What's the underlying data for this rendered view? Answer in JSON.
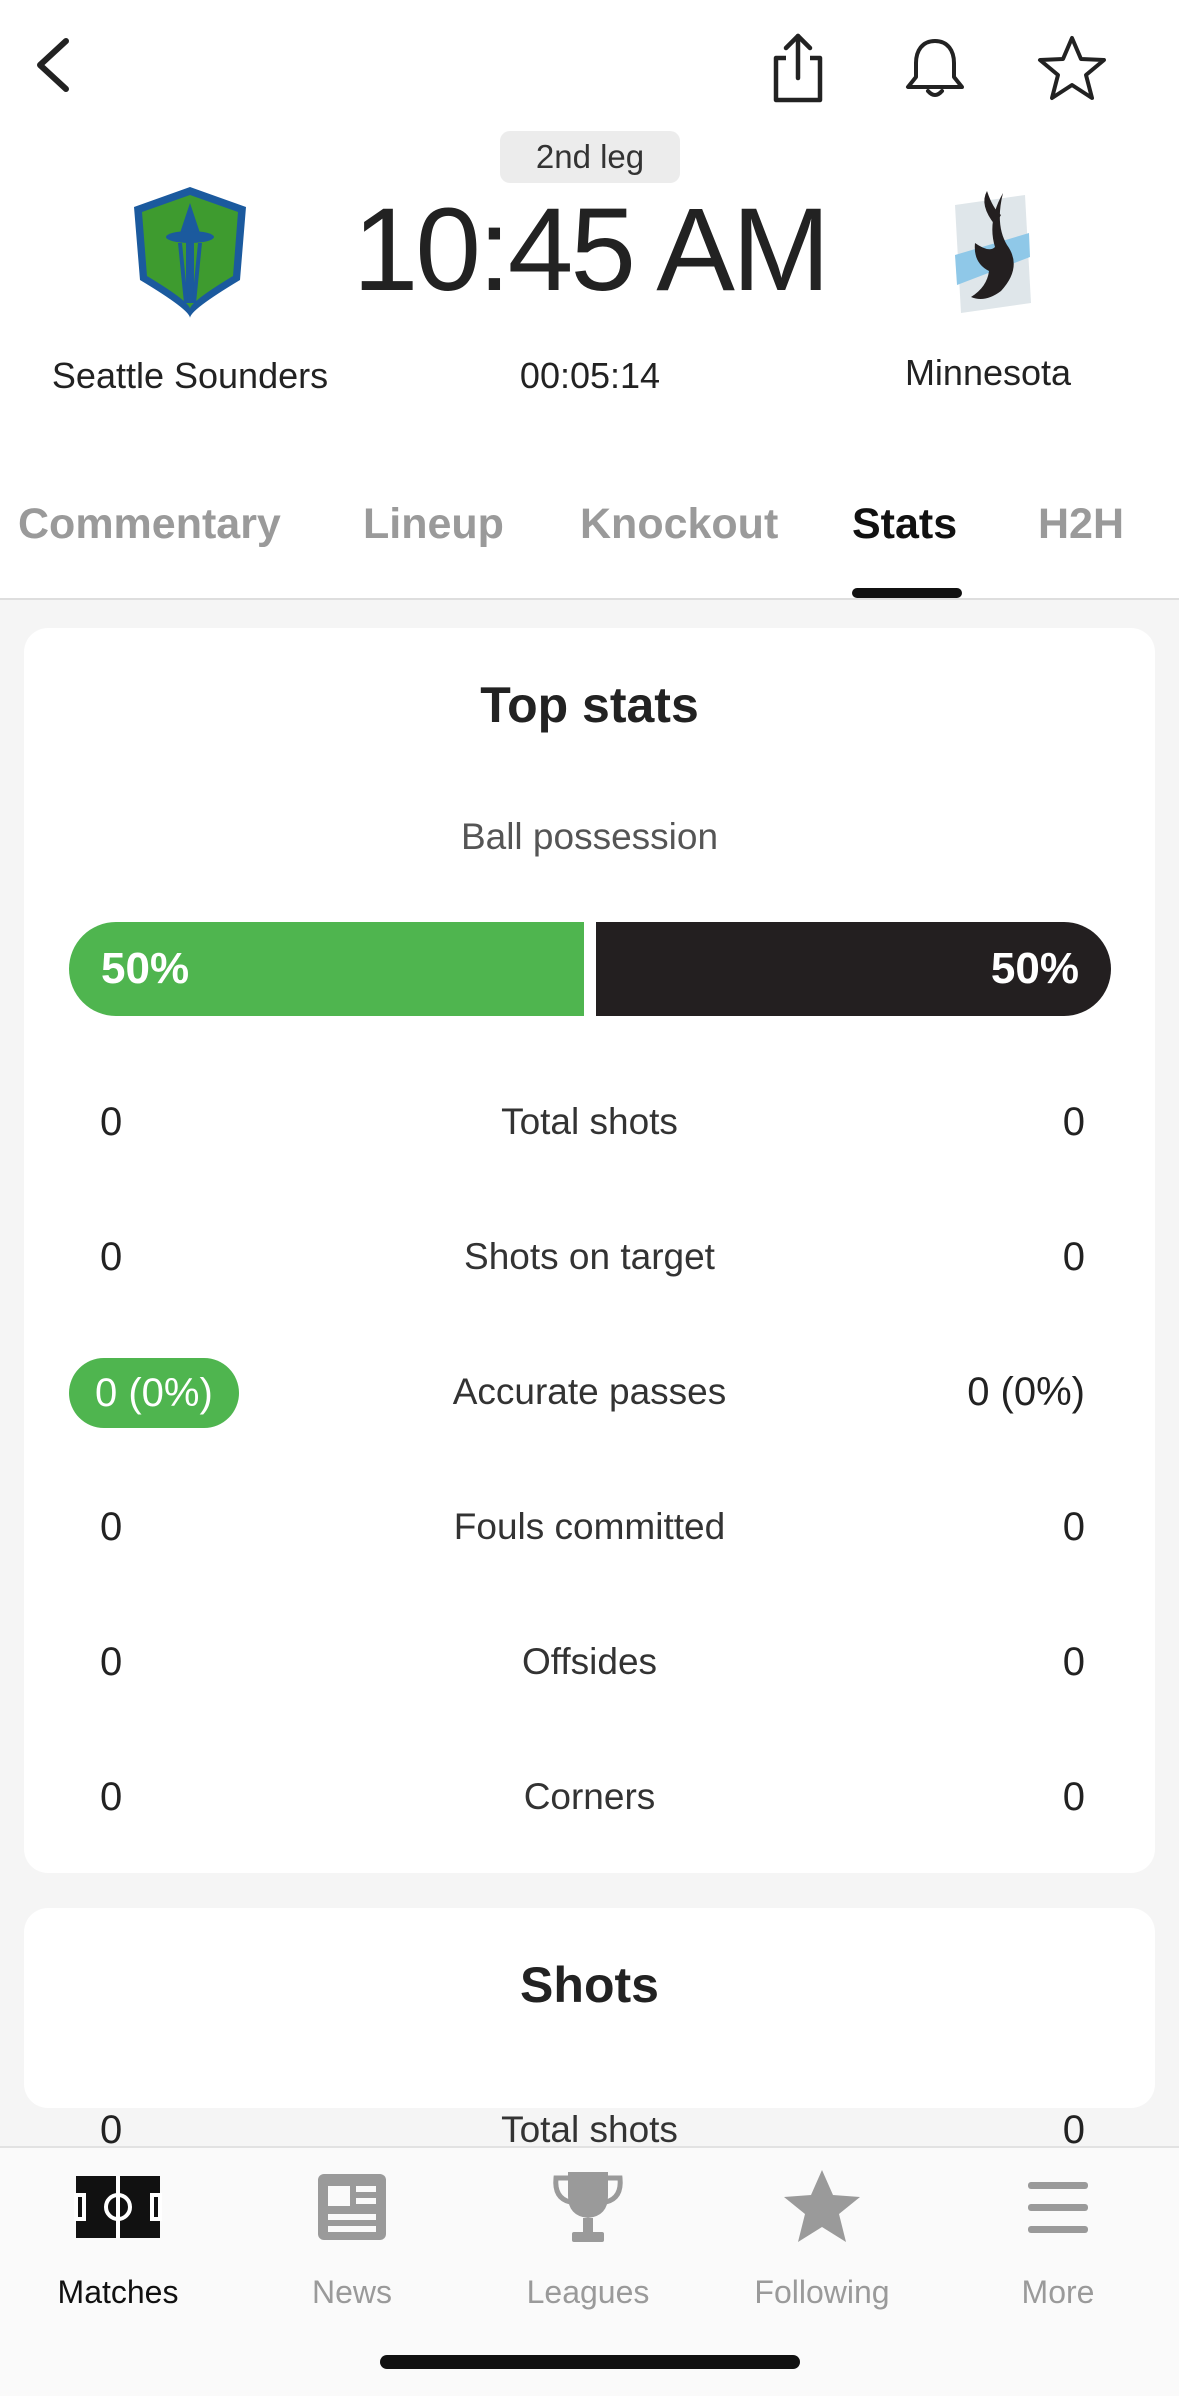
{
  "match": {
    "leg": "2nd leg",
    "kickoff": "10:45 AM",
    "clock": "00:05:14",
    "home_team": "Seattle Sounders",
    "away_team": "Minnesota"
  },
  "tabs": [
    {
      "label": "Commentary"
    },
    {
      "label": "Lineup"
    },
    {
      "label": "Knockout"
    },
    {
      "label": "Stats",
      "active": true
    },
    {
      "label": "H2H"
    }
  ],
  "top_stats": {
    "title": "Top stats",
    "possession": {
      "label": "Ball possession",
      "home": "50%",
      "away": "50%",
      "home_fraction": 0.5
    },
    "rows": [
      {
        "label": "Total shots",
        "home": "0",
        "away": "0"
      },
      {
        "label": "Shots on target",
        "home": "0",
        "away": "0"
      },
      {
        "label": "Accurate passes",
        "home": "0 (0%)",
        "away": "0 (0%)",
        "home_highlight": true
      },
      {
        "label": "Fouls committed",
        "home": "0",
        "away": "0"
      },
      {
        "label": "Offsides",
        "home": "0",
        "away": "0"
      },
      {
        "label": "Corners",
        "home": "0",
        "away": "0"
      }
    ]
  },
  "shots": {
    "title": "Shots",
    "rows": [
      {
        "label": "Total shots",
        "home": "0",
        "away": "0"
      }
    ]
  },
  "nav": [
    {
      "label": "Matches",
      "icon": "pitch-icon",
      "active": true
    },
    {
      "label": "News",
      "icon": "news-icon"
    },
    {
      "label": "Leagues",
      "icon": "trophy-icon"
    },
    {
      "label": "Following",
      "icon": "star-icon"
    },
    {
      "label": "More",
      "icon": "menu-icon"
    }
  ],
  "colors": {
    "accent_green": "#4fb54f",
    "away_dark": "#231f20",
    "tab_inactive": "#9a9a9a",
    "seattle_green": "#3e9b2f",
    "seattle_blue": "#1b5a9e",
    "minnesota_light_blue": "#8fc8e8"
  }
}
